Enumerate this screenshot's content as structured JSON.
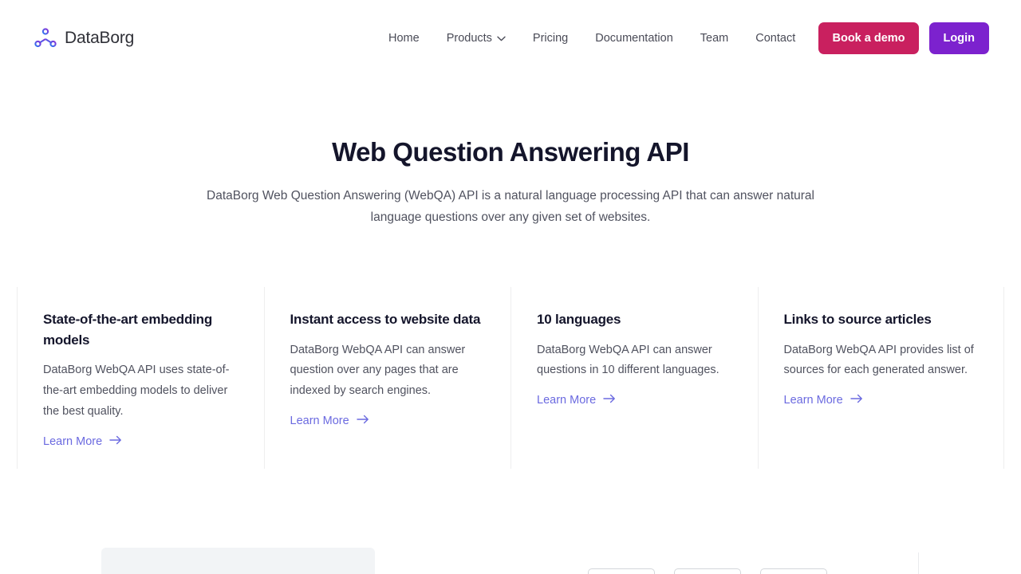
{
  "brand": {
    "name": "DataBorg",
    "logo_icon": "graph-node-icon"
  },
  "nav": {
    "items": [
      {
        "label": "Home",
        "icon": null
      },
      {
        "label": "Products",
        "icon": "chevron-down-icon"
      },
      {
        "label": "Pricing",
        "icon": null
      },
      {
        "label": "Documentation",
        "icon": null
      },
      {
        "label": "Team",
        "icon": null
      },
      {
        "label": "Contact",
        "icon": null
      }
    ]
  },
  "actions": {
    "demo_label": "Book a demo",
    "login_label": "Login",
    "demo_color": "#c9205f",
    "login_color": "#7c22ce"
  },
  "hero": {
    "title": "Web Question Answering API",
    "subtitle": "DataBorg Web Question Answering (WebQA) API is a natural language processing API that can answer natural language questions over any given set of websites."
  },
  "features": {
    "link_label": "Learn More",
    "link_icon": "arrow-right-icon",
    "link_color": "#6b6ae0",
    "items": [
      {
        "title": "State-of-the-art embedding models",
        "desc": "DataBorg WebQA API uses state-of-the-art embedding models to deliver the best quality."
      },
      {
        "title": "Instant access to website data",
        "desc": "DataBorg WebQA API can answer question over any pages that are indexed by search engines."
      },
      {
        "title": "10 languages",
        "desc": "DataBorg WebQA API can answer questions in 10 different languages."
      },
      {
        "title": "Links to source articles",
        "desc": "DataBorg WebQA API provides list of sources for each generated answer."
      }
    ]
  }
}
